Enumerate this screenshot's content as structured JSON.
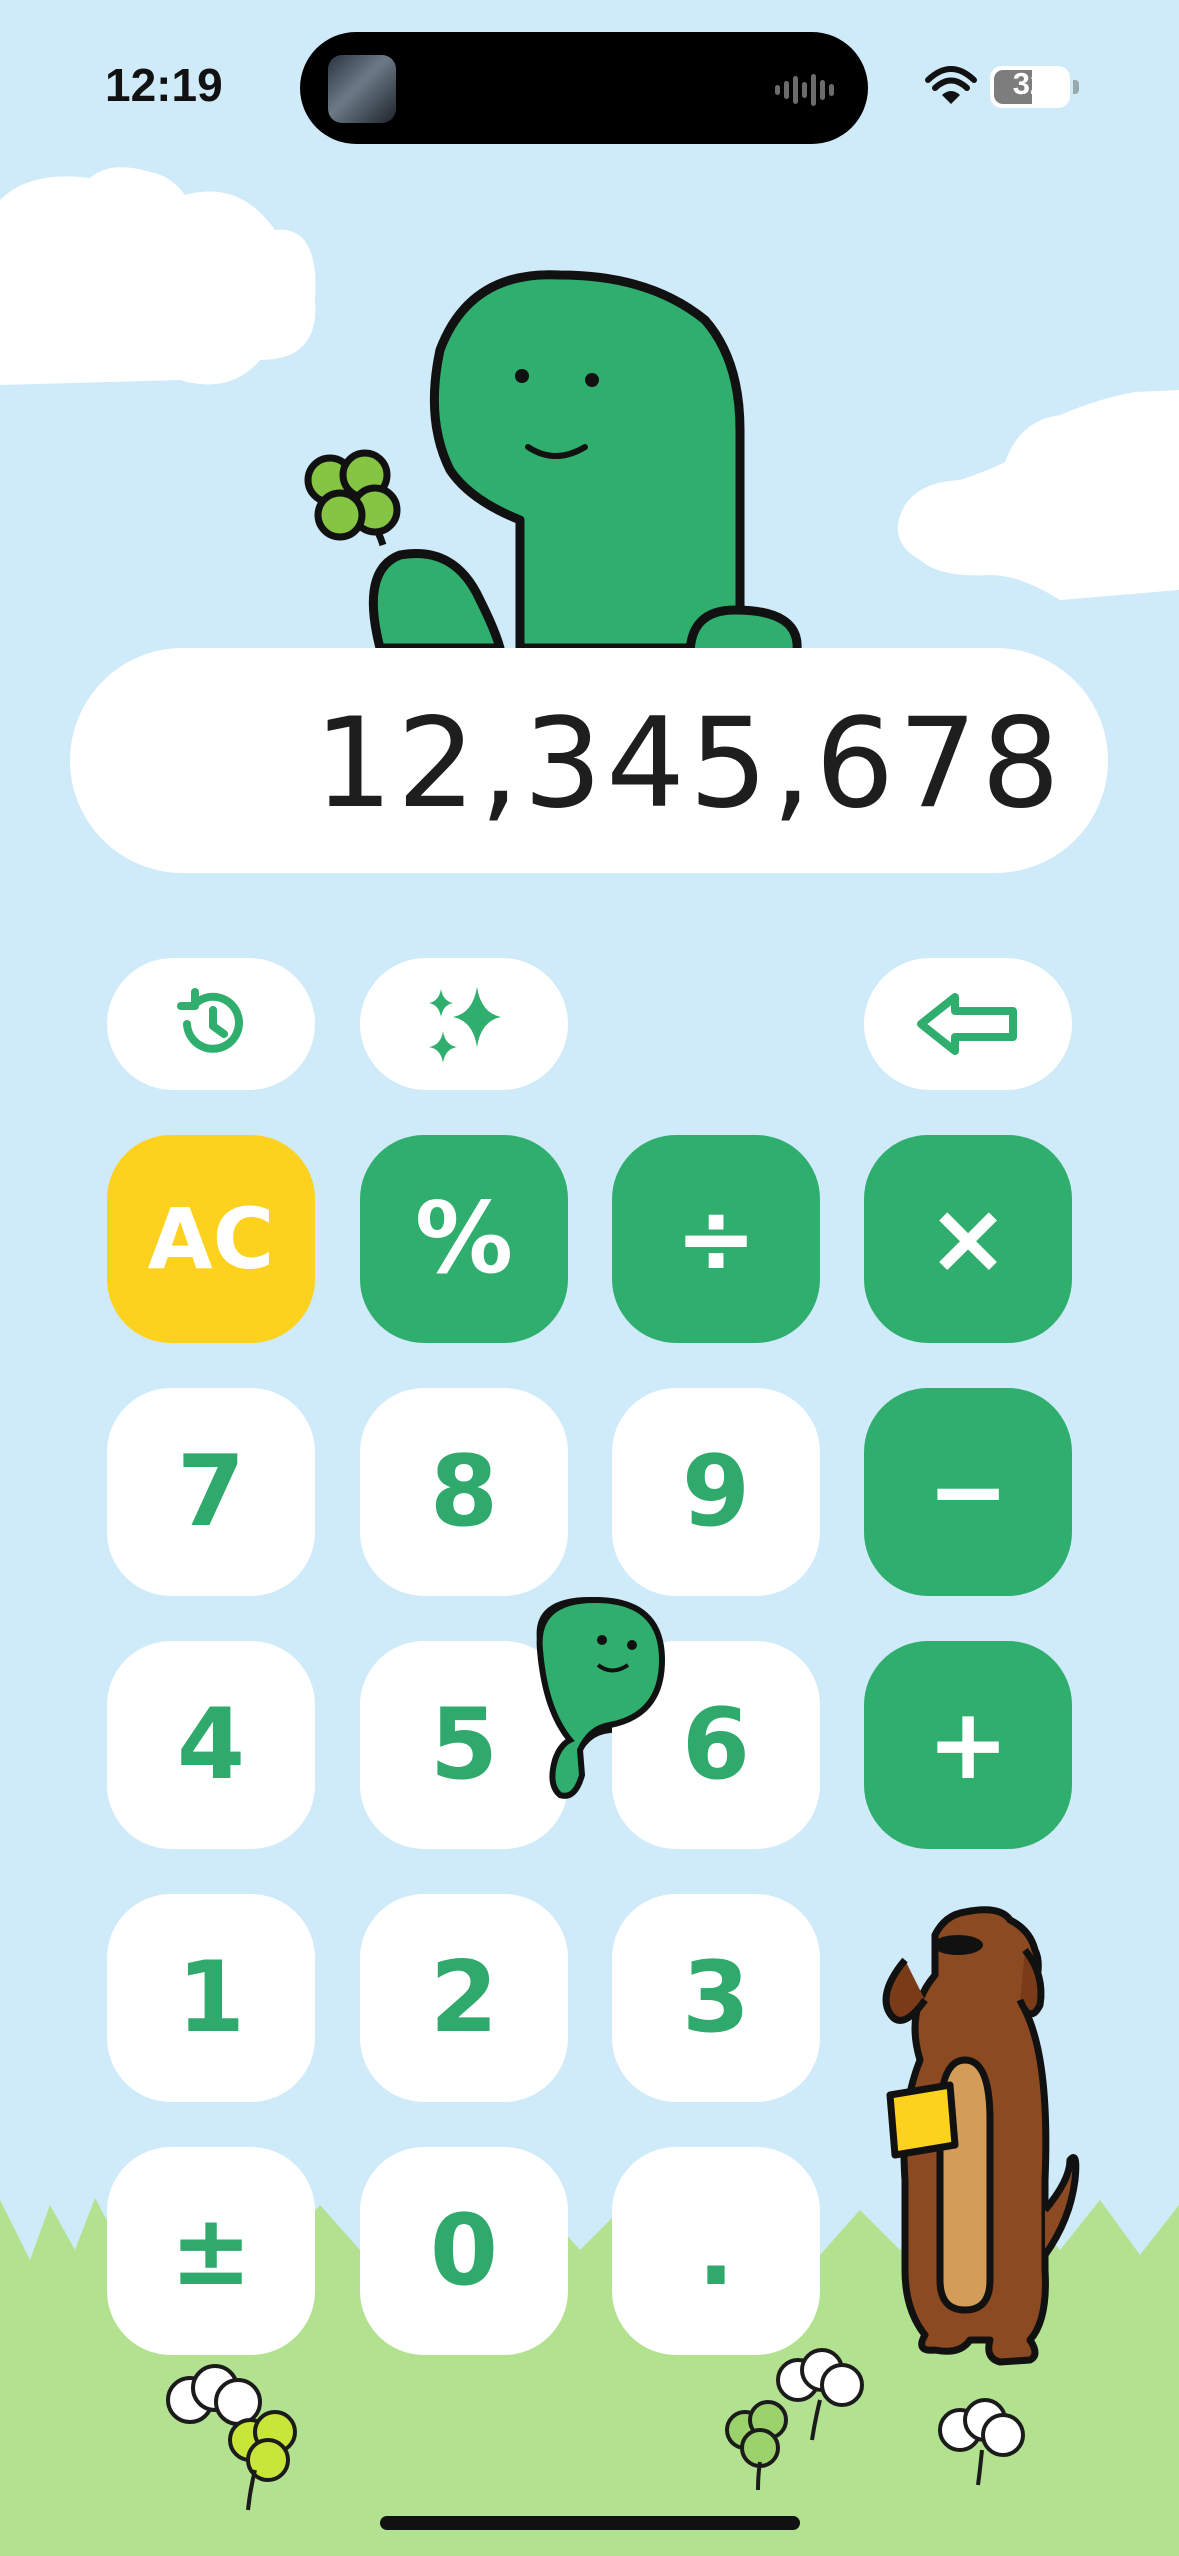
{
  "status": {
    "time": "12:19",
    "battery": "32"
  },
  "display": {
    "value": "12,345,678"
  },
  "toolbar": {
    "history_icon": "history-icon",
    "sparkle_icon": "sparkles-icon",
    "backspace_icon": "backspace-arrow-icon"
  },
  "keys": {
    "ac": "AC",
    "percent": "%",
    "divide": "÷",
    "multiply": "×",
    "seven": "7",
    "eight": "8",
    "nine": "9",
    "minus": "−",
    "four": "4",
    "five": "5",
    "six": "6",
    "plus": "+",
    "one": "1",
    "two": "2",
    "three": "3",
    "plus_minus": "±",
    "zero": "0",
    "decimal": "."
  },
  "colors": {
    "sky": "#cfeaf9",
    "grass": "#b2e18f",
    "accent_green": "#2fae6e",
    "ac_yellow": "#fcd21f",
    "key_white": "#ffffff",
    "digit_text": "#2fa96c"
  }
}
